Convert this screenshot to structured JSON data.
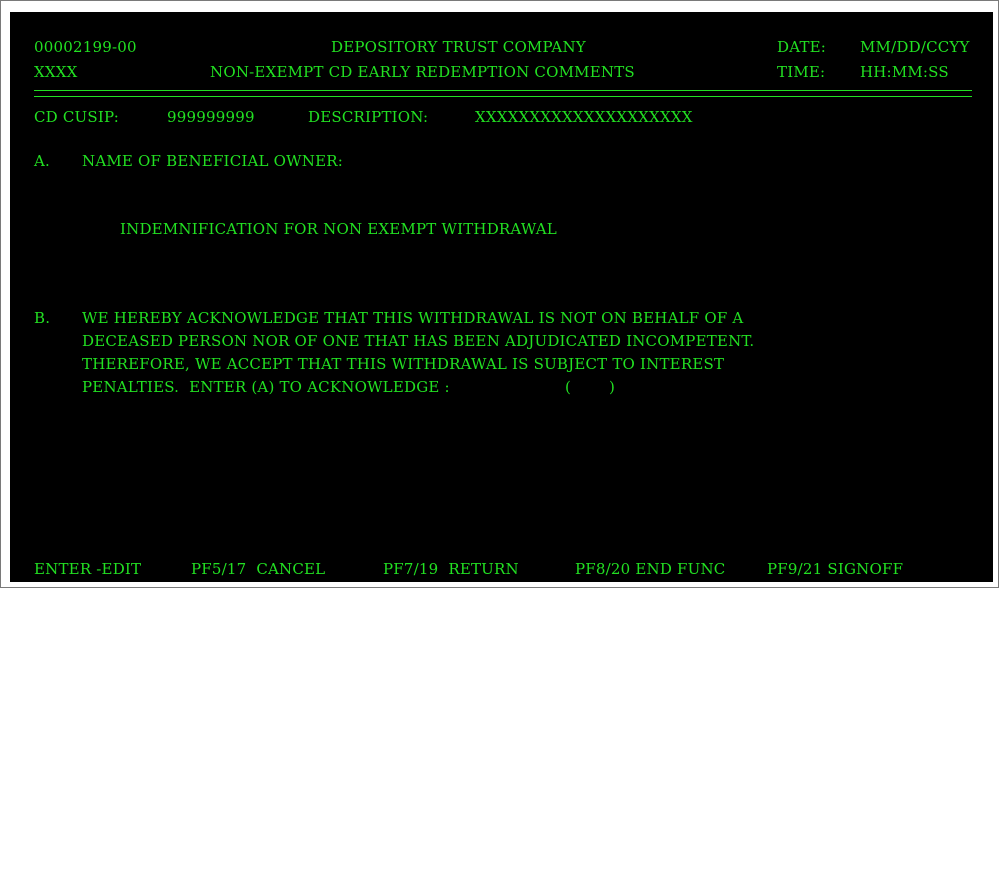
{
  "header": {
    "screen_id": "00002199-00",
    "company": "DEPOSITORY TRUST COMPANY",
    "date_label": "DATE:",
    "date_value": "MM/DD/CCYY",
    "user_id": "XXXX",
    "screen_title": "NON-EXEMPT CD EARLY REDEMPTION COMMENTS",
    "time_label": "TIME:",
    "time_value": "HH:MM:SS"
  },
  "cd_info": {
    "cusip_label": "CD CUSIP:",
    "cusip_value": "999999999",
    "description_label": "DESCRIPTION:",
    "description_value": "XXXXXXXXXXXXXXXXXXXX"
  },
  "section_a": {
    "marker": "A.",
    "label": "NAME OF BENEFICIAL OWNER:"
  },
  "indemnification_heading": "INDEMNIFICATION FOR NON EXEMPT WITHDRAWAL",
  "section_b": {
    "marker": "B.",
    "line1": "WE HEREBY ACKNOWLEDGE THAT THIS WITHDRAWAL IS NOT ON BEHALF OF A",
    "line2": "DECEASED PERSON NOR OF ONE THAT HAS BEEN ADJUDICATED INCOMPETENT.",
    "line3": "THEREFORE, WE ACCEPT THAT THIS WITHDRAWAL IS SUBJECT TO INTEREST",
    "line4_prefix": "PENALTIES.  ENTER (A) TO ACKNOWLEDGE :",
    "ack_open": "(",
    "ack_value": "",
    "ack_close": ")"
  },
  "function_keys": [
    {
      "label": "ENTER -EDIT"
    },
    {
      "label": "PF5/17  CANCEL"
    },
    {
      "label": "PF7/19  RETURN"
    },
    {
      "label": "PF8/20 END FUNC"
    },
    {
      "label": "PF9/21 SIGNOFF"
    }
  ],
  "colors": {
    "background": "#000000",
    "text": "#22e022"
  }
}
